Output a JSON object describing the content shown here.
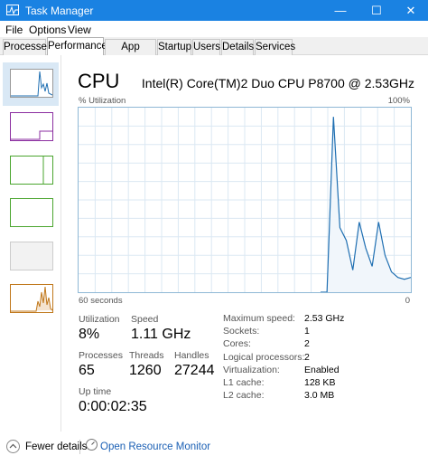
{
  "window": {
    "title": "Task Manager",
    "controls": {
      "minimize": "—",
      "maximize": "☐",
      "close": "✕"
    }
  },
  "menu": [
    "File",
    "Options",
    "View"
  ],
  "tabs": [
    "Processes",
    "Performance",
    "App history",
    "Startup",
    "Users",
    "Details",
    "Services"
  ],
  "active_tab": "Performance",
  "sidebar": {
    "items": [
      {
        "id": "cpu",
        "color": "#1f6fb2",
        "selected": true
      },
      {
        "id": "memory",
        "color": "#8b2ea0",
        "selected": false
      },
      {
        "id": "disk-0",
        "color": "#4aa52e",
        "selected": false
      },
      {
        "id": "disk-1",
        "color": "#4aa52e",
        "selected": false
      },
      {
        "id": "ethernet-disabled",
        "color": "#bbbbbb",
        "selected": false
      },
      {
        "id": "gpu",
        "color": "#c0771a",
        "selected": false
      }
    ]
  },
  "cpu": {
    "title": "CPU",
    "model": "Intel(R) Core(TM)2 Duo CPU P8700 @ 2.53GHz",
    "axis": {
      "top_left": "% Utilization",
      "top_right": "100%",
      "bottom_left": "60 seconds",
      "bottom_right": "0"
    },
    "stats": {
      "utilization_label": "Utilization",
      "utilization": "8%",
      "speed_label": "Speed",
      "speed": "1.11 GHz",
      "processes_label": "Processes",
      "processes": "65",
      "threads_label": "Threads",
      "threads": "1260",
      "handles_label": "Handles",
      "handles": "27244",
      "uptime_label": "Up time",
      "uptime": "0:00:02:35"
    },
    "details": [
      {
        "label": "Maximum speed:",
        "value": "2.53 GHz"
      },
      {
        "label": "Sockets:",
        "value": "1"
      },
      {
        "label": "Cores:",
        "value": "2"
      },
      {
        "label": "Logical processors:",
        "value": "2"
      },
      {
        "label": "Virtualization:",
        "value": "Enabled"
      },
      {
        "label": "L1 cache:",
        "value": "128 KB"
      },
      {
        "label": "L2 cache:",
        "value": "3.0 MB"
      }
    ],
    "history_percent": [
      0,
      0,
      95,
      35,
      28,
      12,
      38,
      24,
      14,
      38,
      20,
      11,
      8,
      7,
      8
    ],
    "line_color": "#1f6fb2",
    "fill_color": "#f1f6fb"
  },
  "footer": {
    "fewer": "Fewer details",
    "resource_monitor": "Open Resource Monitor"
  }
}
